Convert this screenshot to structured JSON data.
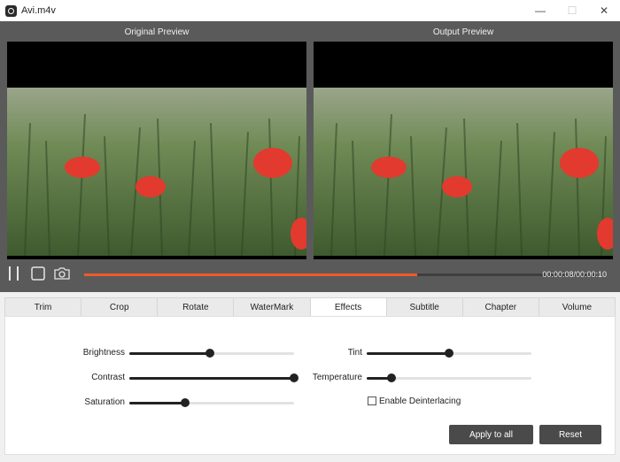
{
  "window": {
    "title": "Avi.m4v",
    "minimize_glyph": "—",
    "maximize_glyph": "☐",
    "close_glyph": "✕"
  },
  "preview": {
    "original_label": "Original Preview",
    "output_label": "Output Preview"
  },
  "player": {
    "timecode": "00:00:08/00:00:10",
    "progress": 0.65,
    "accent_color": "#ef5b2b",
    "icons": [
      "pause-icon",
      "stop-icon",
      "camera-icon"
    ]
  },
  "tabs": [
    {
      "label": "Trim",
      "active": false
    },
    {
      "label": "Crop",
      "active": false
    },
    {
      "label": "Rotate",
      "active": false
    },
    {
      "label": "WaterMark",
      "active": false
    },
    {
      "label": "Effects",
      "active": true
    },
    {
      "label": "Subtitle",
      "active": false
    },
    {
      "label": "Chapter",
      "active": false
    },
    {
      "label": "Volume",
      "active": false
    }
  ],
  "effects": {
    "brightness": {
      "label": "Brightness",
      "value": 0.49
    },
    "contrast": {
      "label": "Contrast",
      "value": 1.0
    },
    "saturation": {
      "label": "Saturation",
      "value": 0.34
    },
    "tint": {
      "label": "Tint",
      "value": 0.5
    },
    "temperature": {
      "label": "Temperature",
      "value": 0.15
    },
    "deinterlace": {
      "label": "Enable Deinterlacing",
      "checked": false
    }
  },
  "buttons": {
    "apply_all": "Apply to all",
    "reset": "Reset"
  }
}
